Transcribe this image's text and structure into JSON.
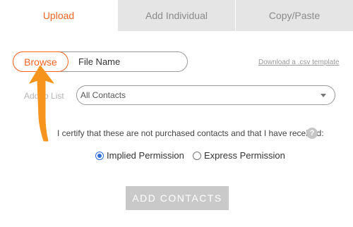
{
  "tabs": [
    {
      "label": "Upload",
      "active": true
    },
    {
      "label": "Add Individual",
      "active": false
    },
    {
      "label": "Copy/Paste",
      "active": false
    }
  ],
  "file": {
    "browse_label": "Browse",
    "file_name_placeholder": "File Name"
  },
  "csv_link": "Download a .csv template",
  "list": {
    "label": "Add to List",
    "selected": "All Contacts"
  },
  "certify_text": "I certify that these are not purchased contacts and that I have received:",
  "help_icon": "?",
  "permissions": [
    {
      "label": "Implied Permission",
      "checked": true
    },
    {
      "label": "Express Permission",
      "checked": false
    }
  ],
  "add_button": "ADD CONTACTS",
  "colors": {
    "accent": "#f26522",
    "annotation_arrow": "#f7941d",
    "radio_checked": "#2e6fd8",
    "disabled_button": "#c9c9c9"
  }
}
